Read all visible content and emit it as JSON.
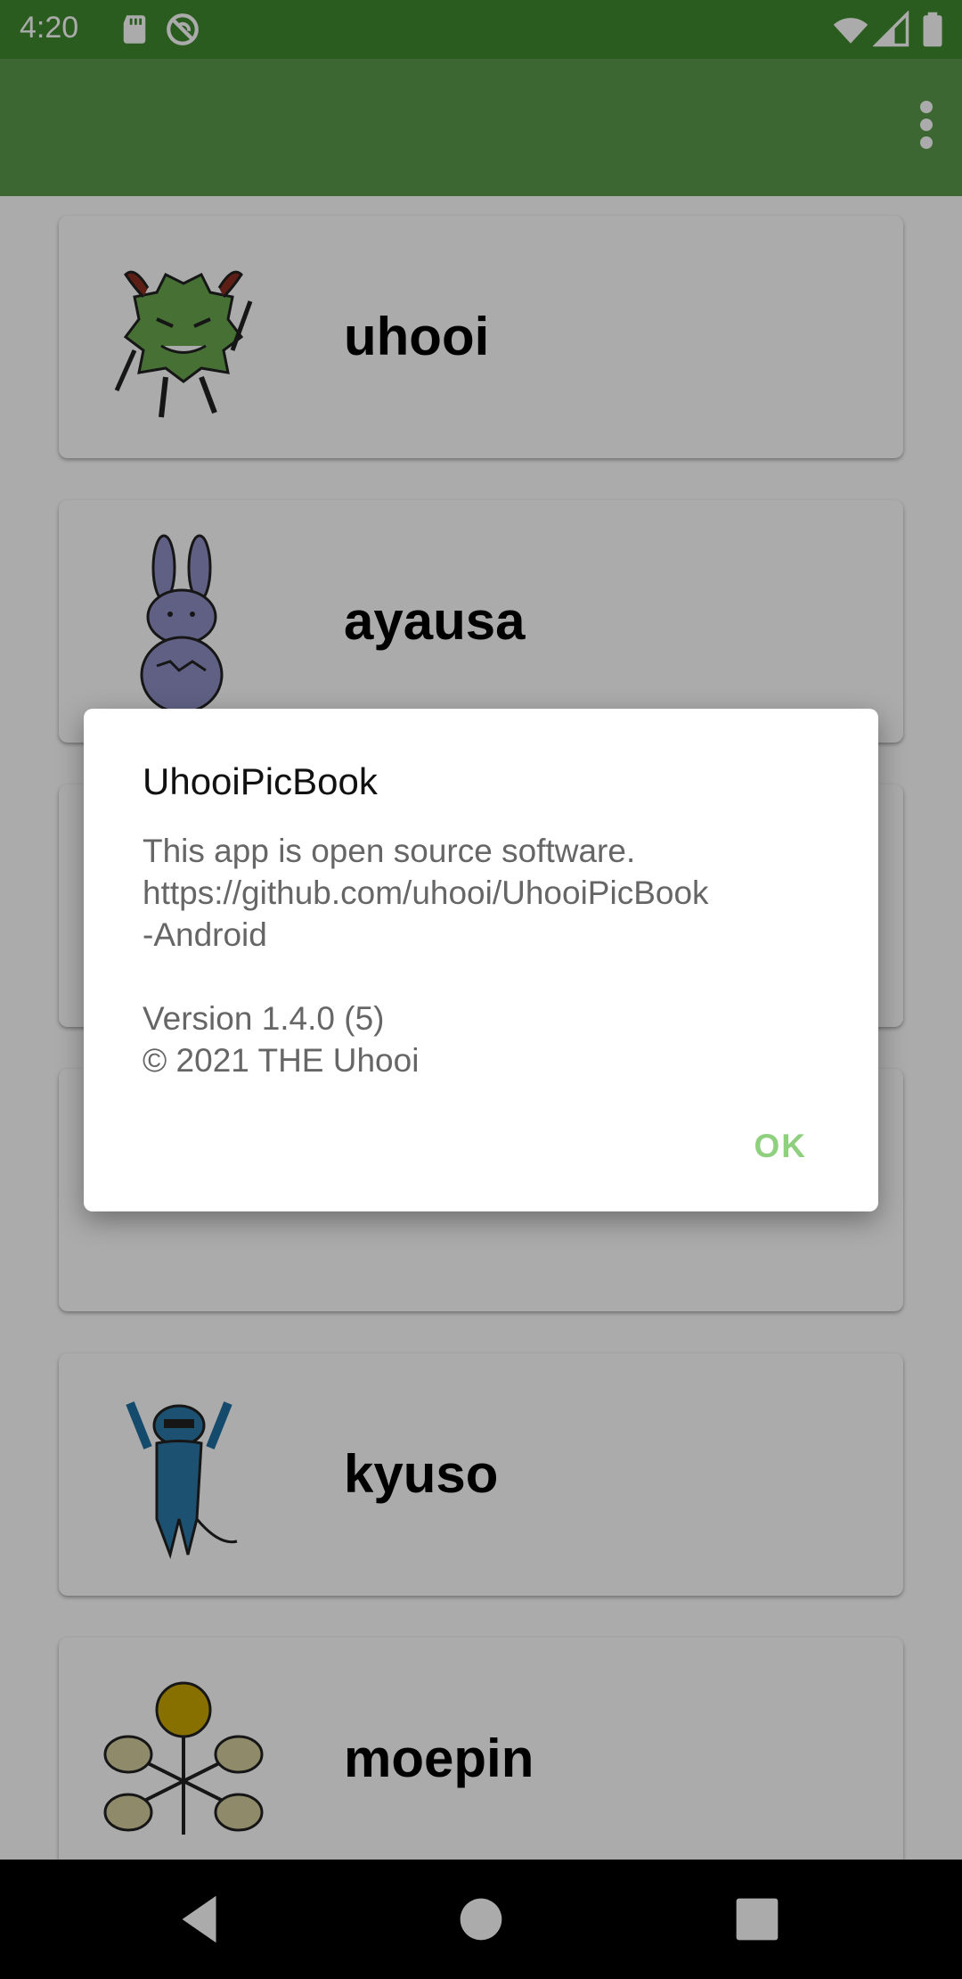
{
  "status_bar": {
    "time": "4:20",
    "color": "#3f8a2f",
    "left_icons": [
      "sd-card-icon",
      "sync-disabled-icon"
    ],
    "right_icons": [
      "wifi-icon",
      "cell-signal-icon",
      "battery-icon"
    ]
  },
  "app_bar": {
    "color": "#5a9a4c",
    "menu_icon": "more-vert-icon"
  },
  "list": {
    "items": [
      {
        "name": "uhooi",
        "icon": "uhooi-monster-icon"
      },
      {
        "name": "ayausa",
        "icon": "ayausa-rabbit-icon"
      },
      {
        "name": "",
        "icon": "creature-icon"
      },
      {
        "name": "",
        "icon": "creature-icon"
      },
      {
        "name": "kyuso",
        "icon": "kyuso-mouse-icon"
      },
      {
        "name": "moepin",
        "icon": "moepin-flower-icon"
      }
    ]
  },
  "dialog": {
    "title": "UhooiPicBook",
    "message": "This app is open source software.\nhttps://github.com/uhooi/UhooiPicBook\n-Android\n\nVersion 1.4.0 (5)\n© 2021 THE Uhooi",
    "ok_label": "OK",
    "ok_color": "#8fd07f"
  },
  "nav_bar": {
    "buttons": [
      "back-icon",
      "home-icon",
      "recents-icon"
    ]
  }
}
